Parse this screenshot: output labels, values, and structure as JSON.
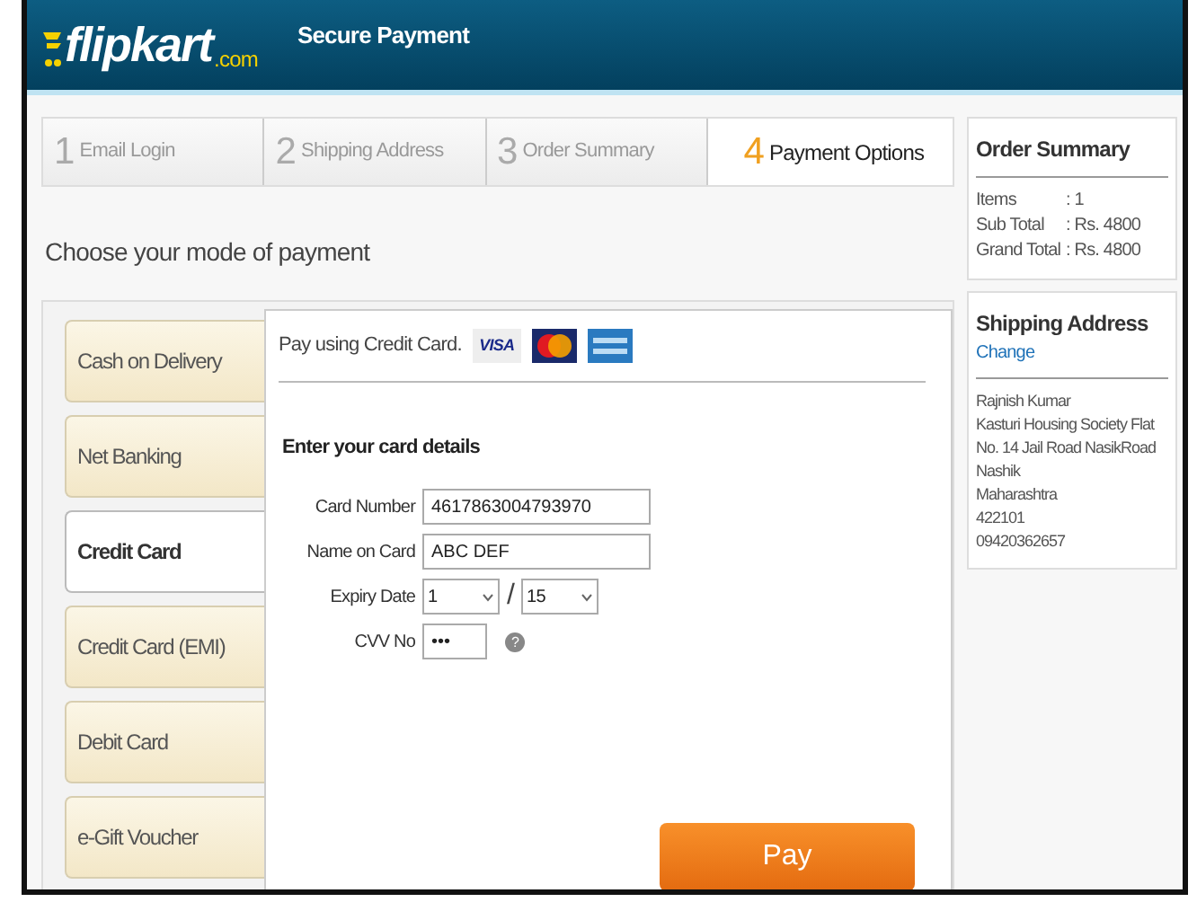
{
  "header": {
    "logo_text": "flipkart",
    "logo_suffix": ".com",
    "title": "Secure Payment"
  },
  "steps": [
    {
      "number": "1",
      "label": "Email Login",
      "selected": false
    },
    {
      "number": "2",
      "label": "Shipping Address",
      "selected": false
    },
    {
      "number": "3",
      "label": "Order Summary",
      "selected": false
    },
    {
      "number": "4",
      "label": "Payment Options",
      "selected": true
    }
  ],
  "heading": "Choose your mode of payment",
  "payment_modes": [
    {
      "label": "Cash on Delivery",
      "selected": false
    },
    {
      "label": "Net Banking",
      "selected": false
    },
    {
      "label": "Credit Card",
      "selected": true
    },
    {
      "label": "Credit Card (EMI)",
      "selected": false
    },
    {
      "label": "Debit Card",
      "selected": false
    },
    {
      "label": "e-Gift Voucher",
      "selected": false
    }
  ],
  "card_panel": {
    "intro": "Pay using Credit Card.",
    "card_logos": [
      {
        "kind": "visa",
        "text": "VISA"
      },
      {
        "kind": "mastercard"
      },
      {
        "kind": "amex"
      }
    ],
    "form_title": "Enter your card details",
    "fields": [
      {
        "kind": "text",
        "label": "Card Number",
        "value": "4617863004793970"
      },
      {
        "kind": "text",
        "label": "Name on Card",
        "value": "ABC DEF"
      },
      {
        "kind": "expiry",
        "label": "Expiry Date",
        "month": "1",
        "separator": "/",
        "year": "15"
      },
      {
        "kind": "cvv",
        "label": "CVV No",
        "value": "•••",
        "help": "?"
      }
    ],
    "pay_button": "Pay"
  },
  "order_summary": {
    "title": "Order Summary",
    "rows": [
      {
        "label": "Items",
        "value": ": 1"
      },
      {
        "label": "Sub Total",
        "value": ": Rs. 4800"
      },
      {
        "label": "Grand Total",
        "value": ": Rs. 4800"
      }
    ]
  },
  "shipping_address": {
    "title": "Shipping Address",
    "change_link": "Change",
    "lines": [
      "Rajnish Kumar",
      "Kasturi Housing Society Flat",
      "No. 14 Jail Road NasikRoad",
      "Nashik",
      "Maharashtra",
      "422101",
      "09420362657"
    ]
  }
}
